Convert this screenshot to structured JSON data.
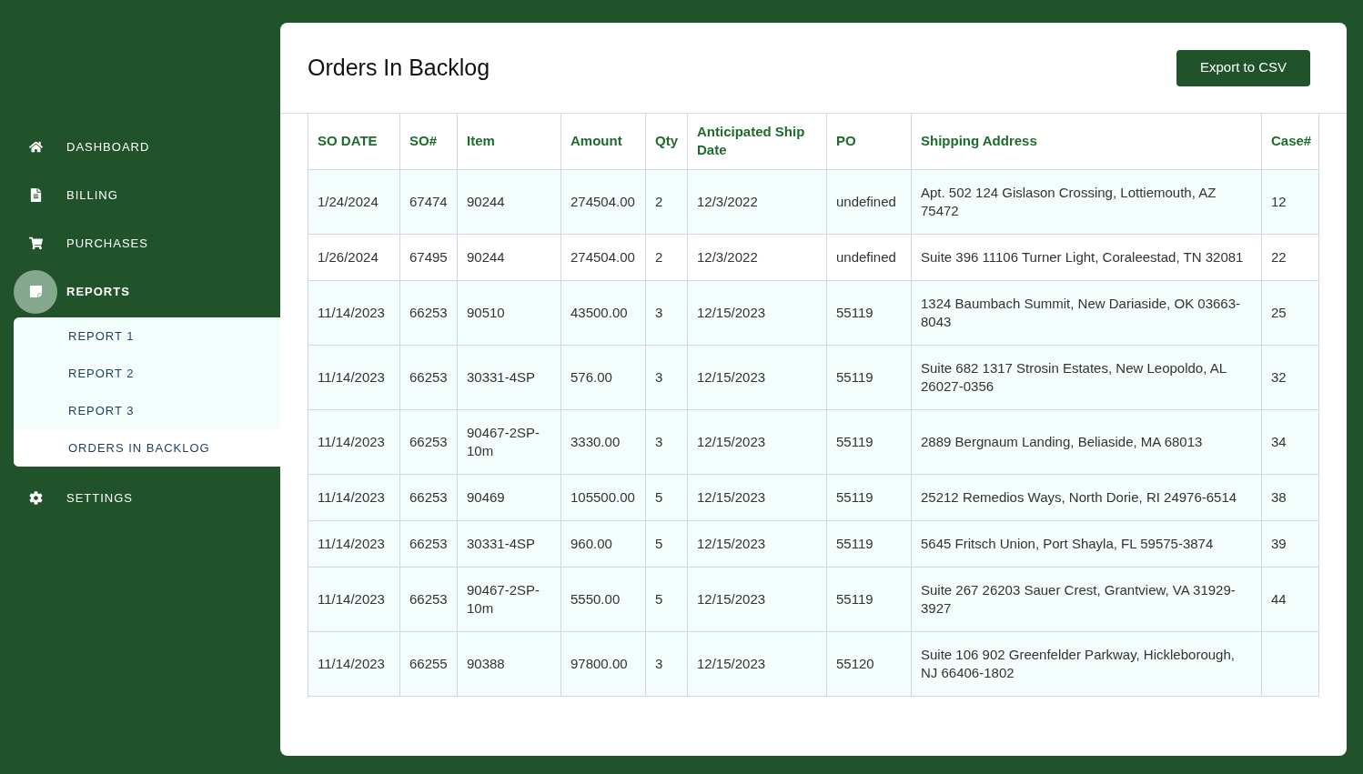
{
  "sidebar": {
    "items": [
      {
        "label": "DASHBOARD",
        "selected": false
      },
      {
        "label": "BILLING",
        "selected": false
      },
      {
        "label": "PURCHASES",
        "selected": false
      },
      {
        "label": "REPORTS",
        "selected": true,
        "expanded": true,
        "children": [
          {
            "label": "REPORT 1",
            "selected": false
          },
          {
            "label": "REPORT 2",
            "selected": false
          },
          {
            "label": "REPORT 3",
            "selected": false
          },
          {
            "label": "ORDERS IN BACKLOG",
            "selected": true
          }
        ]
      },
      {
        "label": "SETTINGS",
        "selected": false
      }
    ]
  },
  "page": {
    "title": "Orders In Backlog",
    "export_button": "Export to CSV"
  },
  "table": {
    "columns": [
      "SO DATE",
      "SO#",
      "Item",
      "Amount",
      "Qty",
      "Anticipated Ship Date",
      "PO",
      "Shipping Address",
      "Case#"
    ],
    "rows": [
      [
        "1/24/2024",
        "67474",
        "90244",
        "274504.00",
        "2",
        "12/3/2022",
        "undefined",
        "Apt. 502 124 Gislason Crossing, Lottiemouth, AZ 75472",
        "12"
      ],
      [
        "1/26/2024",
        "67495",
        "90244",
        "274504.00",
        "2",
        "12/3/2022",
        "undefined",
        "Suite 396 11106 Turner Light, Coraleestad, TN 32081",
        "22"
      ],
      [
        "11/14/2023",
        "66253",
        "90510",
        "43500.00",
        "3",
        "12/15/2023",
        "55119",
        "1324 Baumbach Summit, New Dariaside, OK 03663-8043",
        "25"
      ],
      [
        "11/14/2023",
        "66253",
        "30331-4SP",
        "576.00",
        "3",
        "12/15/2023",
        "55119",
        "Suite 682 1317 Strosin Estates, New Leopoldo, AL 26027-0356",
        "32"
      ],
      [
        "11/14/2023",
        "66253",
        "90467-2SP-10m",
        "3330.00",
        "3",
        "12/15/2023",
        "55119",
        "2889 Bergnaum Landing, Beliaside, MA 68013",
        "34"
      ],
      [
        "11/14/2023",
        "66253",
        "90469",
        "105500.00",
        "5",
        "12/15/2023",
        "55119",
        "25212 Remedios Ways, North Dorie, RI 24976-6514",
        "38"
      ],
      [
        "11/14/2023",
        "66253",
        "30331-4SP",
        "960.00",
        "5",
        "12/15/2023",
        "55119",
        "5645 Fritsch Union, Port Shayla, FL 59575-3874",
        "39"
      ],
      [
        "11/14/2023",
        "66253",
        "90467-2SP-10m",
        "5550.00",
        "5",
        "12/15/2023",
        "55119",
        "Suite 267 26203 Sauer Crest, Grantview, VA 31929-3927",
        "44"
      ],
      [
        "11/14/2023",
        "66255",
        "90388",
        "97800.00",
        "3",
        "12/15/2023",
        "55120",
        "Suite 106 902 Greenfelder Parkway, Hickleborough, NJ 66406-1802",
        ""
      ]
    ]
  }
}
